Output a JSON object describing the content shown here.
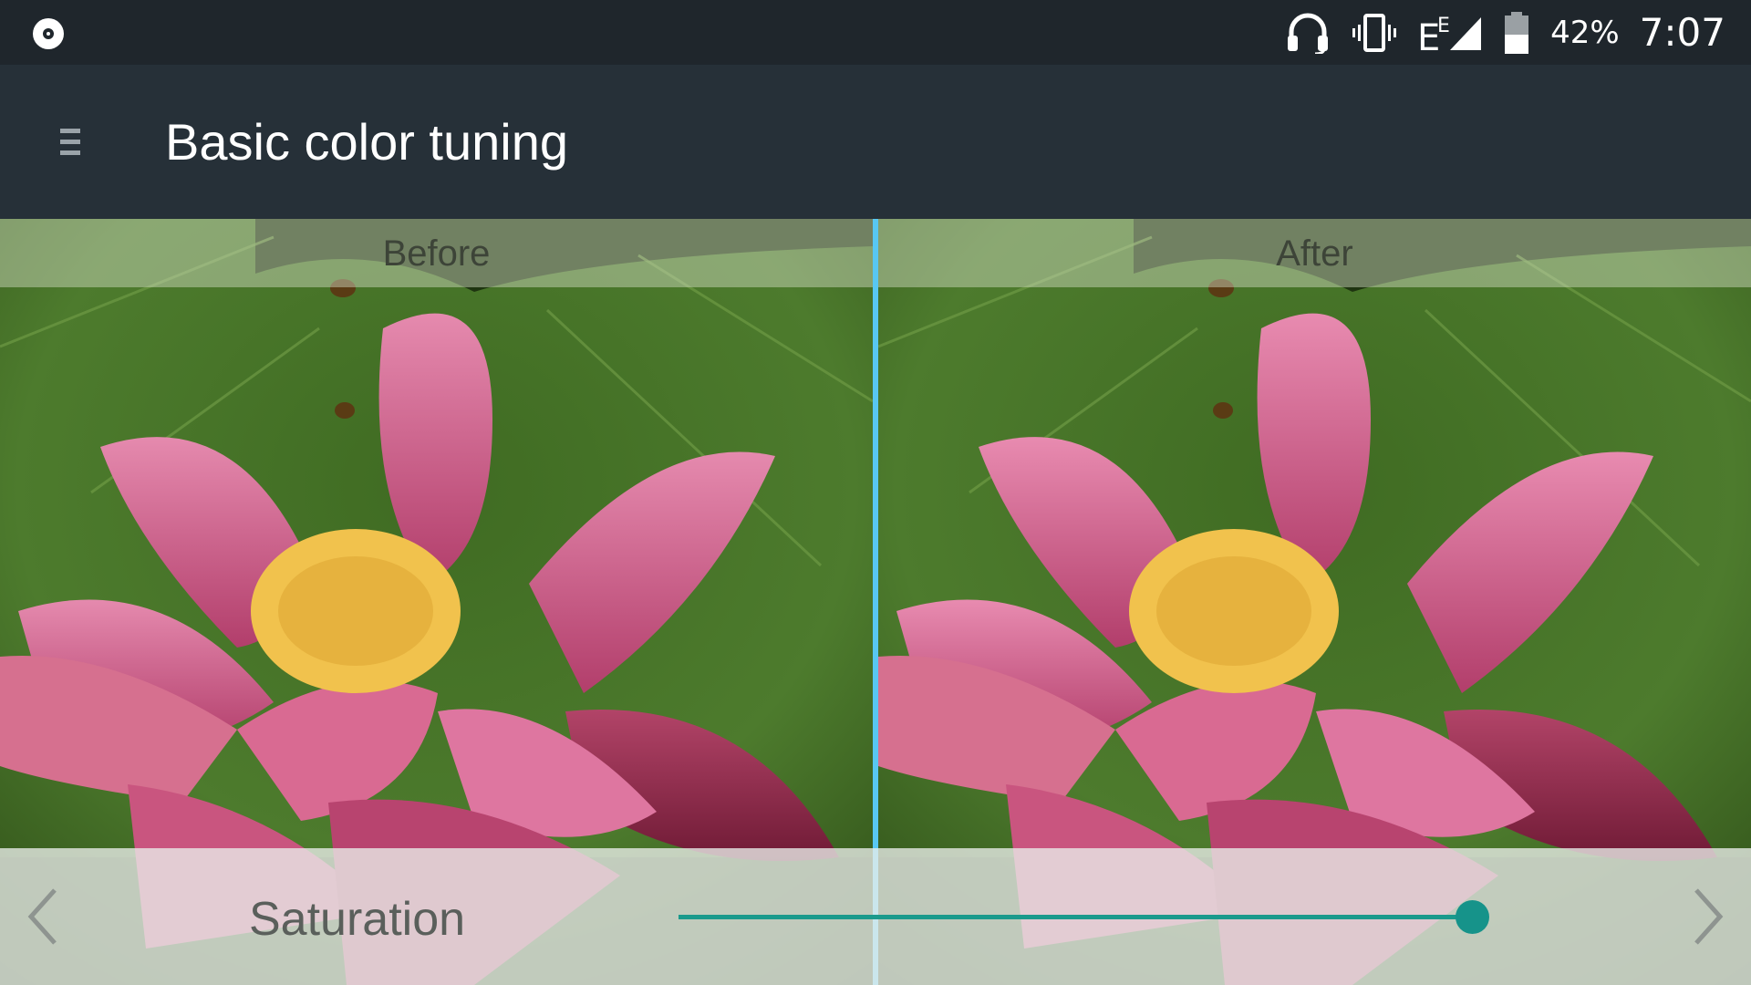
{
  "status_bar": {
    "left_icon": "record-icon",
    "icons": [
      "headset-icon",
      "vibrate-icon",
      "network-e-icon",
      "signal-icon",
      "battery-icon"
    ],
    "network_label": "E",
    "battery_text": "42%",
    "time": "7:07"
  },
  "app_bar": {
    "menu_icon": "menu-icon",
    "title": "Basic color tuning"
  },
  "compare": {
    "before_label": "Before",
    "after_label": "After",
    "divider_color": "#58c7f2"
  },
  "control": {
    "prev_icon": "chevron-left-icon",
    "next_icon": "chevron-right-icon",
    "setting_label": "Saturation",
    "slider_value_fraction": 0.98,
    "accent_color": "#16938a"
  }
}
